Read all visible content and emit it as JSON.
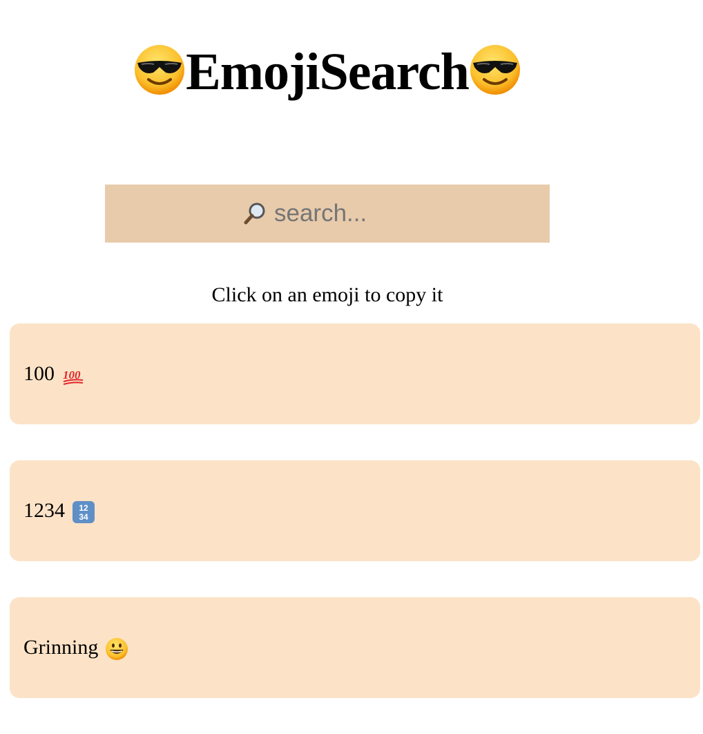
{
  "app": {
    "title": "EmojiSearch"
  },
  "search": {
    "placeholder": "search...",
    "value": ""
  },
  "hint": "Click on an emoji to copy it",
  "results": [
    {
      "label": "100",
      "icon": "hundred-points-icon"
    },
    {
      "label": "1234",
      "icon": "input-numbers-icon"
    },
    {
      "label": "Grinning",
      "icon": "grinning-face-icon"
    }
  ],
  "colors": {
    "search_bg": "#e8cbab",
    "card_bg": "#fce3c7",
    "placeholder": "#757575"
  }
}
